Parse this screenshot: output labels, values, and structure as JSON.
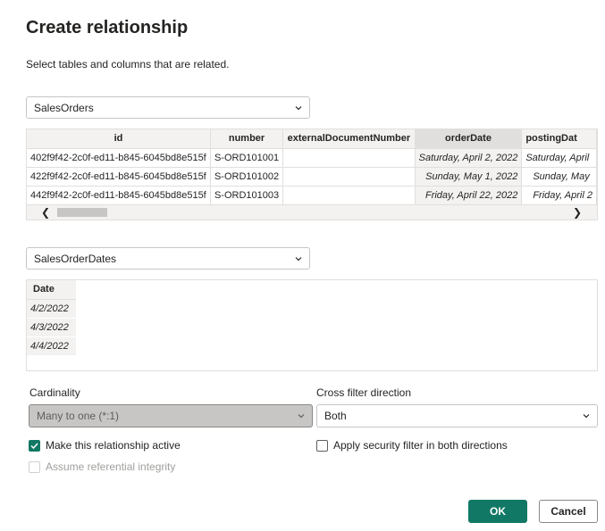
{
  "dialog": {
    "title": "Create relationship",
    "subtitle": "Select tables and columns that are related."
  },
  "table1": {
    "selected": "SalesOrders",
    "columns": [
      "id",
      "number",
      "externalDocumentNumber",
      "orderDate",
      "postingDat"
    ],
    "rows": [
      [
        "402f9f42-2c0f-ed11-b845-6045bd8e515f",
        "S-ORD101001",
        "",
        "Saturday, April 2, 2022",
        "Saturday, April"
      ],
      [
        "422f9f42-2c0f-ed11-b845-6045bd8e515f",
        "S-ORD101002",
        "",
        "Sunday, May 1, 2022",
        "Sunday, May"
      ],
      [
        "442f9f42-2c0f-ed11-b845-6045bd8e515f",
        "S-ORD101003",
        "",
        "Friday, April 22, 2022",
        "Friday, April 2"
      ]
    ]
  },
  "table2": {
    "selected": "SalesOrderDates",
    "columns": [
      "Date"
    ],
    "rows": [
      [
        "4/2/2022"
      ],
      [
        "4/3/2022"
      ],
      [
        "4/4/2022"
      ]
    ]
  },
  "cardinality": {
    "label": "Cardinality",
    "value": "Many to one (*:1)"
  },
  "crossFilter": {
    "label": "Cross filter direction",
    "value": "Both"
  },
  "options": {
    "active": "Make this relationship active",
    "security": "Apply security filter in both directions",
    "referential": "Assume referential integrity"
  },
  "buttons": {
    "ok": "OK",
    "cancel": "Cancel"
  },
  "colors": {
    "accent": "#117865"
  }
}
